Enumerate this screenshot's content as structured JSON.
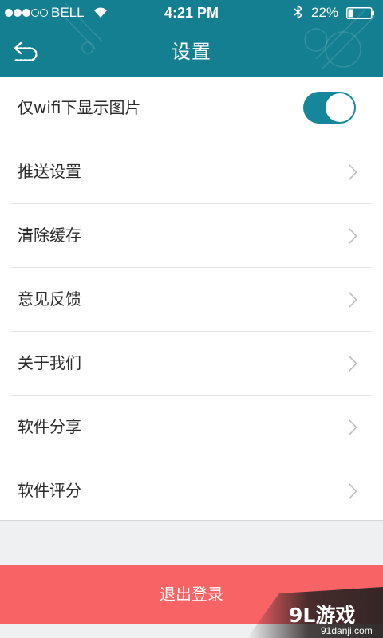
{
  "status_bar": {
    "carrier": "BELL",
    "time": "4:21 PM",
    "battery": "22%",
    "signal_strength": 3,
    "signal_max": 5,
    "battery_level": 0.22
  },
  "nav": {
    "title": "设置",
    "back_icon": "back-arrow-icon"
  },
  "settings": {
    "wifi_images": {
      "label": "仅wifi下显示图片",
      "enabled": true
    },
    "items": [
      {
        "label": "推送设置"
      },
      {
        "label": "清除缓存"
      },
      {
        "label": "意见反馈"
      },
      {
        "label": "关于我们"
      },
      {
        "label": "软件分享"
      },
      {
        "label": "软件评分"
      }
    ]
  },
  "logout": {
    "label": "退出登录"
  },
  "watermark": {
    "logo": "9L游戏",
    "url": "91danji.com"
  },
  "colors": {
    "header": "#137f91",
    "toggle_on": "#16879b",
    "logout": "#f86466",
    "background": "#eef0f1"
  }
}
